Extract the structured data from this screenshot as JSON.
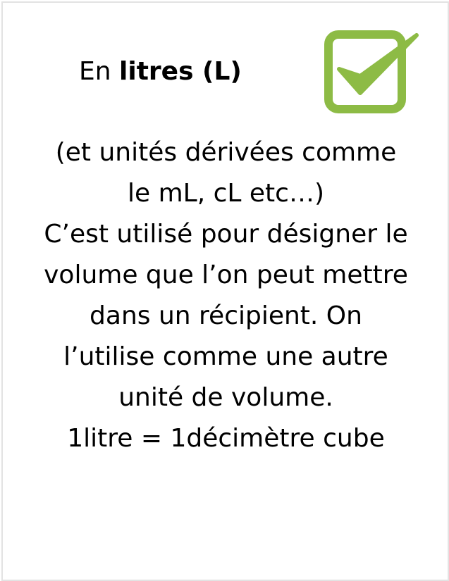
{
  "heading": {
    "prefix": "En ",
    "strong": "litres (L)"
  },
  "icon": {
    "name": "checkbox-checked-icon",
    "color": "#8dbb45"
  },
  "body_lines": [
    "(et unités dérivées comme",
    "le mL, cL etc…)",
    "C’est utilisé pour désigner le",
    "volume que l’on peut mettre",
    "dans un récipient. On",
    "l’utilise comme une autre",
    "unité de volume.",
    "1litre = 1décimètre cube"
  ]
}
